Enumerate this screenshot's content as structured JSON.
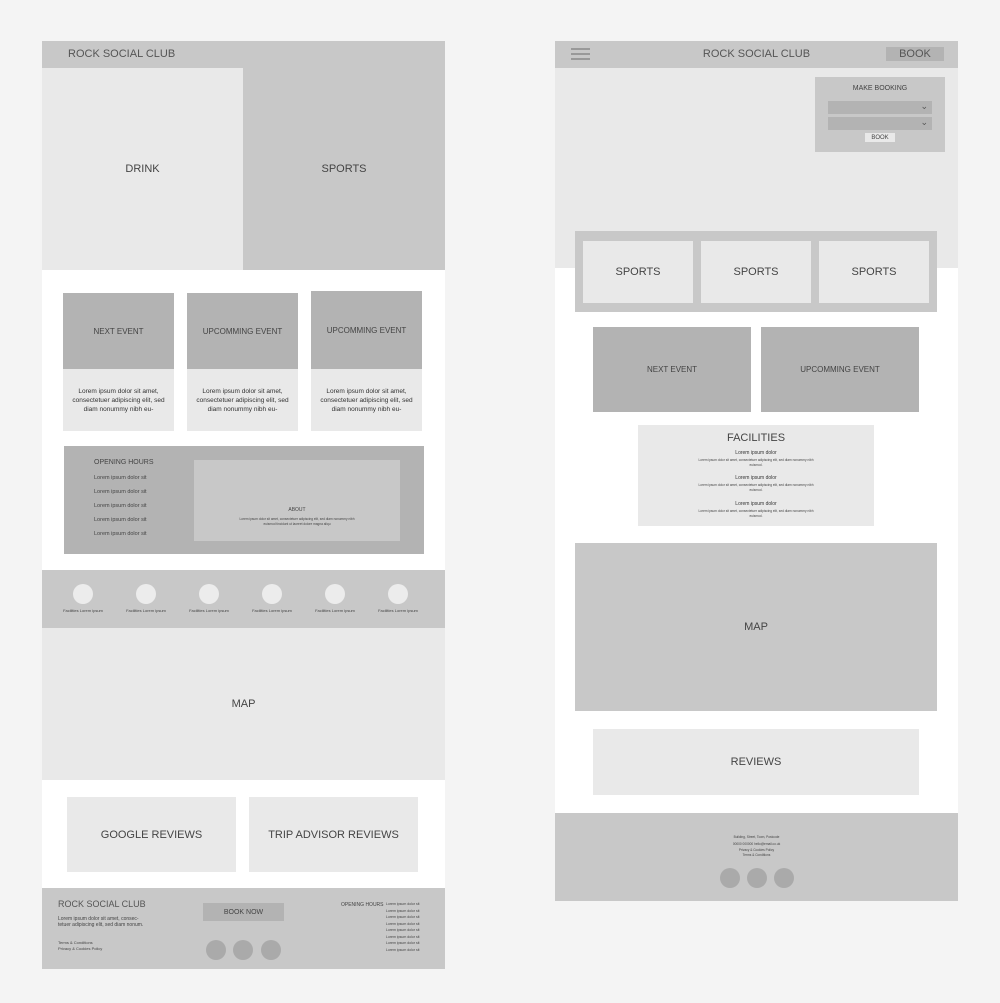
{
  "desktop": {
    "header": {
      "title": "ROCK SOCIAL CLUB"
    },
    "hero": {
      "left": "DRINK",
      "right": "SPORTS"
    },
    "events": [
      {
        "title": "NEXT EVENT",
        "text": "Lorem ipsum dolor sit amet, consectetuer adipiscing elit, sed diam nonummy nibh eu-"
      },
      {
        "title": "UPCOMMING EVENT",
        "text": "Lorem ipsum dolor sit amet, consectetuer adipiscing elit, sed diam nonummy nibh eu-"
      },
      {
        "title": "UPCOMMING EVENT",
        "text": "Lorem ipsum dolor sit amet, consectetuer adipiscing elit, sed diam nonummy nibh eu-"
      }
    ],
    "opening_hours": {
      "title": "OPENING HOURS",
      "lines": [
        "Lorem ipsum dolor sit",
        "Lorem ipsum dolor sit",
        "Lorem ipsum dolor sit",
        "Lorem ipsum dolor sit",
        "Lorem ipsum dolor sit"
      ]
    },
    "about": {
      "title": "ABOUT",
      "text": "Lorem ipsum dolor sit amet, consectetuer adipiscing elit, sed diam nonummy nibh euismod tincidunt ut laoreet dolore magna aliqu"
    },
    "facilities": [
      "Facilities Lorem ipsum",
      "Facilities Lorem ipsum",
      "Facilities Lorem ipsum",
      "Facilities Lorem ipsum",
      "Facilities Lorem ipsum",
      "Facilities Lorem ipsum"
    ],
    "map": "MAP",
    "reviews": {
      "google": "GOOGLE REVIEWS",
      "trip": "TRIP ADVISOR REVIEWS"
    },
    "footer": {
      "title": "ROCK SOCIAL CLUB",
      "text": "Lorem ipsum dolor sit amet, consec- tetuer adipiscing elit, sed diam nonum.",
      "terms": "Terms & Conditions",
      "privacy": "Privacy & Cookies Policy",
      "book_now": "BOOK NOW",
      "hours_title": "OPENING HOURS",
      "hours_lines": [
        "Lorem ipsum dolor sit",
        "Lorem ipsum dolor sit",
        "Lorem ipsum dolor sit",
        "Lorem ipsum dolor sit",
        "Lorem ipsum dolor sit",
        "Lorem ipsum dolor sit",
        "Lorem ipsum dolor sit",
        "Lorem ipsum dolor sit"
      ]
    }
  },
  "mobile": {
    "header": {
      "title": "ROCK SOCIAL CLUB",
      "book": "BOOK",
      "menu_icon": "hamburger-icon"
    },
    "booking": {
      "title": "MAKE BOOKING",
      "button": "BOOK"
    },
    "sports": [
      "SPORTS",
      "SPORTS",
      "SPORTS"
    ],
    "events": [
      "NEXT EVENT",
      "UPCOMMING EVENT"
    ],
    "facilities": {
      "title": "FACILITIES",
      "items": [
        {
          "heading": "Lorem ipsum dolor",
          "text": "Lorem ipsum dolor sit amet, consectetuer adipiscing elit, sed diam nonummy nibh euismod."
        },
        {
          "heading": "Lorem ipsum dolor",
          "text": "Lorem ipsum dolor sit amet, consectetuer adipiscing elit, sed diam nonummy nibh euismod."
        },
        {
          "heading": "Lorem ipsum dolor",
          "text": "Lorem ipsum dolor sit amet, consectetuer adipiscing elit, sed diam nonummy nibh euismod."
        }
      ]
    },
    "map": "MAP",
    "reviews": "REVIEWS",
    "footer": {
      "address": "Building, Street, Town, Postcode",
      "contact": "00000 000000 hello@email.co.uk",
      "privacy": "Privacy & Cookies Policy",
      "terms": "Terms & Conditions"
    }
  },
  "colors": {
    "light": "#e9e9e9",
    "mid": "#c8c8c8",
    "dark": "#b3b3b3",
    "bg": "#f4f4f4"
  }
}
